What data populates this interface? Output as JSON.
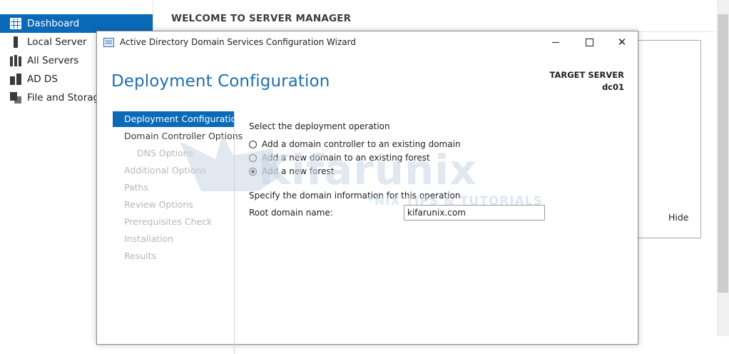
{
  "server_manager": {
    "nav": [
      {
        "label": "Dashboard",
        "active": true,
        "icon": "dashboard-icon"
      },
      {
        "label": "Local Server",
        "active": false,
        "icon": "server-icon"
      },
      {
        "label": "All Servers",
        "active": false,
        "icon": "servers-icon"
      },
      {
        "label": "AD DS",
        "active": false,
        "icon": "ad-ds-icon"
      },
      {
        "label": "File and Storage",
        "active": false,
        "icon": "file-storage-icon"
      }
    ],
    "heading": "WELCOME TO SERVER MANAGER",
    "hide_label": "Hide"
  },
  "wizard": {
    "title": "Active Directory Domain Services Configuration Wizard",
    "page_heading": "Deployment Configuration",
    "target_server_label": "TARGET SERVER",
    "target_server_value": "dc01",
    "steps": [
      {
        "label": "Deployment Configuration",
        "state": "active"
      },
      {
        "label": "Domain Controller Options",
        "state": "enabled"
      },
      {
        "label": "DNS Options",
        "state": "disabled"
      },
      {
        "label": "Additional Options",
        "state": "disabled"
      },
      {
        "label": "Paths",
        "state": "disabled"
      },
      {
        "label": "Review Options",
        "state": "disabled"
      },
      {
        "label": "Prerequisites Check",
        "state": "disabled"
      },
      {
        "label": "Installation",
        "state": "disabled"
      },
      {
        "label": "Results",
        "state": "disabled"
      }
    ],
    "deployment_label": "Select the deployment operation",
    "options": [
      {
        "label": "Add a domain controller to an existing domain",
        "checked": false
      },
      {
        "label": "Add a new domain to an existing forest",
        "checked": false
      },
      {
        "label": "Add a new forest",
        "checked": true
      }
    ],
    "domain_info_label": "Specify the domain information for this operation",
    "root_domain_label": "Root domain name:",
    "root_domain_value": "kifarunix.com"
  },
  "watermark": {
    "text": "Kifarunix",
    "subtext": "*NIX TIPS & TUTORIALS"
  }
}
